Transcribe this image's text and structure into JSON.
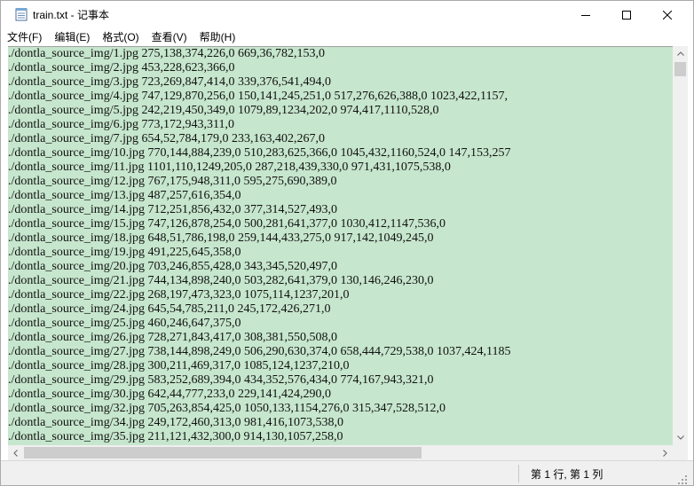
{
  "window": {
    "title": "train.txt - 记事本",
    "icon": "notepad-icon",
    "buttons": {
      "minimize": "minimize-icon",
      "maximize": "maximize-icon",
      "close": "close-icon"
    }
  },
  "menu": [
    "文件(F)",
    "编辑(E)",
    "格式(O)",
    "查看(V)",
    "帮助(H)"
  ],
  "editor": {
    "background": "#c6e6cd",
    "lines": [
      "./dontla_source_img/1.jpg 275,138,374,226,0 669,36,782,153,0",
      "./dontla_source_img/2.jpg 453,228,623,366,0",
      "./dontla_source_img/3.jpg 723,269,847,414,0 339,376,541,494,0",
      "./dontla_source_img/4.jpg 747,129,870,256,0 150,141,245,251,0 517,276,626,388,0 1023,422,1157,",
      "./dontla_source_img/5.jpg 242,219,450,349,0 1079,89,1234,202,0 974,417,1110,528,0",
      "./dontla_source_img/6.jpg 773,172,943,311,0",
      "./dontla_source_img/7.jpg 654,52,784,179,0 233,163,402,267,0",
      "./dontla_source_img/10.jpg 770,144,884,239,0 510,283,625,366,0 1045,432,1160,524,0 147,153,257",
      "./dontla_source_img/11.jpg 1101,110,1249,205,0 287,218,439,330,0 971,431,1075,538,0",
      "./dontla_source_img/12.jpg 767,175,948,311,0 595,275,690,389,0",
      "./dontla_source_img/13.jpg 487,257,616,354,0",
      "./dontla_source_img/14.jpg 712,251,856,432,0 377,314,527,493,0",
      "./dontla_source_img/15.jpg 747,126,878,254,0 500,281,641,377,0 1030,412,1147,536,0",
      "./dontla_source_img/18.jpg 648,51,786,198,0 259,144,433,275,0 917,142,1049,245,0",
      "./dontla_source_img/19.jpg 491,225,645,358,0",
      "./dontla_source_img/20.jpg 703,246,855,428,0 343,345,520,497,0",
      "./dontla_source_img/21.jpg 744,134,898,240,0 503,282,641,379,0 130,146,246,230,0",
      "./dontla_source_img/22.jpg 268,197,473,323,0 1075,114,1237,201,0",
      "./dontla_source_img/24.jpg 645,54,785,211,0 245,172,426,271,0",
      "./dontla_source_img/25.jpg 460,246,647,375,0",
      "./dontla_source_img/26.jpg 728,271,843,417,0 308,381,550,508,0",
      "./dontla_source_img/27.jpg 738,144,898,249,0 506,290,630,374,0 658,444,729,538,0 1037,424,1185",
      "./dontla_source_img/28.jpg 300,211,469,317,0 1085,124,1237,210,0",
      "./dontla_source_img/29.jpg 583,252,689,394,0 434,352,576,434,0 774,167,943,321,0",
      "./dontla_source_img/30.jpg 642,44,777,233,0 229,141,424,290,0",
      "./dontla_source_img/32.jpg 705,263,854,425,0 1050,133,1154,276,0 315,347,528,512,0",
      "./dontla_source_img/34.jpg 249,172,460,313,0 981,416,1073,538,0",
      "./dontla_source_img/35.jpg 211,121,432,300,0 914,130,1057,258,0"
    ]
  },
  "scrollbars": {
    "up": "scroll-up-arrow-icon",
    "down": "scroll-down-arrow-icon",
    "left": "scroll-left-arrow-icon",
    "right": "scroll-right-arrow-icon"
  },
  "status": {
    "position": "第 1 行, 第 1 列"
  }
}
